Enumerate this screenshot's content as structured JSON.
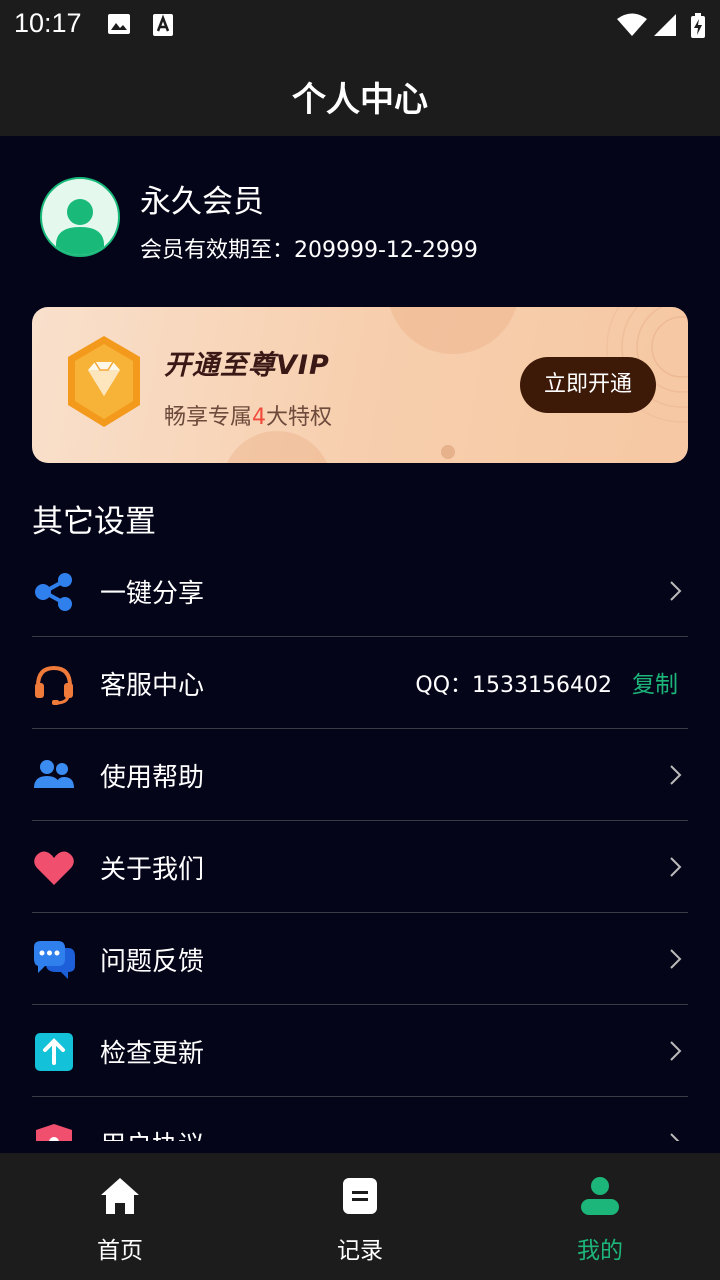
{
  "status_bar": {
    "time": "10:17"
  },
  "header": {
    "title": "个人中心"
  },
  "profile": {
    "name": "永久会员",
    "expiry": "会员有效期至：209999-12-2999"
  },
  "vip_banner": {
    "title": "开通至尊VIP",
    "subtitle_prefix": "畅享专属",
    "subtitle_number": "4",
    "subtitle_suffix": "大特权",
    "button_label": "立即开通"
  },
  "settings": {
    "section_title": "其它设置",
    "items": [
      {
        "label": "一键分享",
        "icon": "share-icon"
      },
      {
        "label": "客服中心",
        "icon": "headset-icon",
        "qq": "QQ：1533156402",
        "copy_label": "复制"
      },
      {
        "label": "使用帮助",
        "icon": "users-icon"
      },
      {
        "label": "关于我们",
        "icon": "heart-icon"
      },
      {
        "label": "问题反馈",
        "icon": "chat-icon"
      },
      {
        "label": "检查更新",
        "icon": "upload-icon"
      },
      {
        "label": "用户协议",
        "icon": "shield-icon"
      }
    ]
  },
  "tabs": [
    {
      "label": "首页",
      "icon": "home-icon"
    },
    {
      "label": "记录",
      "icon": "record-icon"
    },
    {
      "label": "我的",
      "icon": "user-icon",
      "active": true
    }
  ],
  "colors": {
    "accent": "#1db67a",
    "background": "#05051a",
    "bar": "#1c1c1c",
    "vip_button": "#3d1908"
  }
}
